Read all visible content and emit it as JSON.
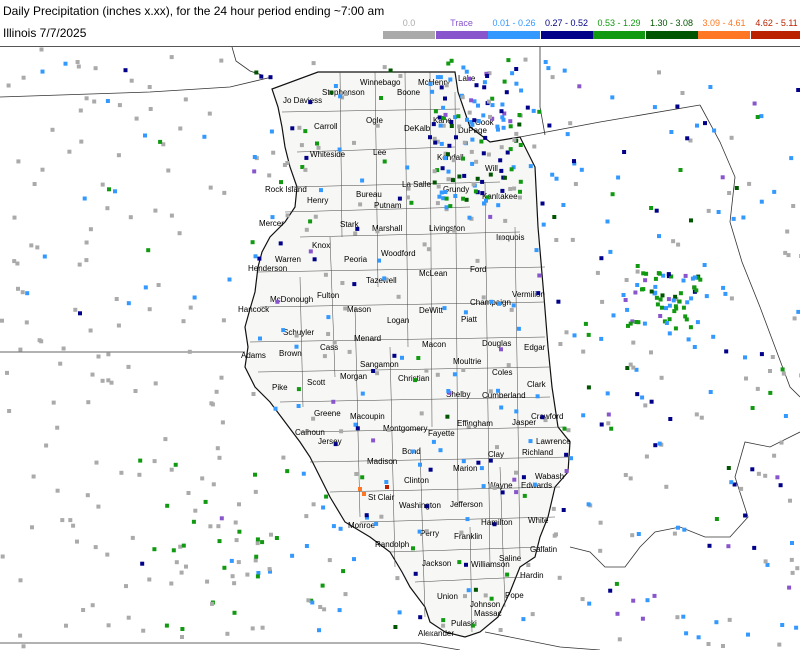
{
  "header": {
    "title": "Daily Precipitation (inches  x.xx),  for the 24 hour period ending ~7:00 am",
    "subtitle": "Illinois 7/7/2025"
  },
  "legend": [
    {
      "label": "0.0",
      "color": "#aaaaaa",
      "text_color": "#aaaaaa"
    },
    {
      "label": "Trace",
      "color": "#8855cc",
      "text_color": "#8855cc"
    },
    {
      "label": "0.01 - 0.26",
      "color": "#3399ff",
      "text_color": "#3399ff"
    },
    {
      "label": "0.27 - 0.52",
      "color": "#000088",
      "text_color": "#000088"
    },
    {
      "label": "0.53 - 1.29",
      "color": "#119911",
      "text_color": "#119911"
    },
    {
      "label": "1.30 - 3.08",
      "color": "#005500",
      "text_color": "#005500"
    },
    {
      "label": "3.09 - 4.61",
      "color": "#ff7722",
      "text_color": "#ff7722"
    },
    {
      "label": "4.62 - 5.11",
      "color": "#bb2200",
      "text_color": "#bb2200"
    }
  ],
  "map": {
    "state_fill": "#f7f7f5",
    "counties": [
      {
        "name": "Jo Daviess"
      },
      {
        "name": "Stephenson"
      },
      {
        "name": "Winnebago"
      },
      {
        "name": "Boone"
      },
      {
        "name": "McHenry"
      },
      {
        "name": "Lake"
      },
      {
        "name": "Carroll"
      },
      {
        "name": "Ogle"
      },
      {
        "name": "DeKalb"
      },
      {
        "name": "Kane"
      },
      {
        "name": "Cook"
      },
      {
        "name": "DuPage"
      },
      {
        "name": "Whiteside"
      },
      {
        "name": "Lee"
      },
      {
        "name": "Kendall"
      },
      {
        "name": "Will"
      },
      {
        "name": "Rock Island"
      },
      {
        "name": "Henry"
      },
      {
        "name": "Bureau"
      },
      {
        "name": "La Salle"
      },
      {
        "name": "Grundy"
      },
      {
        "name": "Kankakee"
      },
      {
        "name": "Putnam"
      },
      {
        "name": "Mercer"
      },
      {
        "name": "Stark"
      },
      {
        "name": "Marshall"
      },
      {
        "name": "Livingston"
      },
      {
        "name": "Iroquois"
      },
      {
        "name": "Knox"
      },
      {
        "name": "Warren"
      },
      {
        "name": "Peoria"
      },
      {
        "name": "Woodford"
      },
      {
        "name": "Henderson"
      },
      {
        "name": "Tazewell"
      },
      {
        "name": "McLean"
      },
      {
        "name": "Ford"
      },
      {
        "name": "Fulton"
      },
      {
        "name": "McDonough"
      },
      {
        "name": "Hancock"
      },
      {
        "name": "Mason"
      },
      {
        "name": "DeWitt"
      },
      {
        "name": "Champaign"
      },
      {
        "name": "Vermilion"
      },
      {
        "name": "Schuyler"
      },
      {
        "name": "Logan"
      },
      {
        "name": "Piatt"
      },
      {
        "name": "Menard"
      },
      {
        "name": "Cass"
      },
      {
        "name": "Adams"
      },
      {
        "name": "Brown"
      },
      {
        "name": "Macon"
      },
      {
        "name": "Douglas"
      },
      {
        "name": "Edgar"
      },
      {
        "name": "Sangamon"
      },
      {
        "name": "Morgan"
      },
      {
        "name": "Moultrie"
      },
      {
        "name": "Scott"
      },
      {
        "name": "Christian"
      },
      {
        "name": "Pike"
      },
      {
        "name": "Coles"
      },
      {
        "name": "Clark"
      },
      {
        "name": "Shelby"
      },
      {
        "name": "Cumberland"
      },
      {
        "name": "Greene"
      },
      {
        "name": "Macoupin"
      },
      {
        "name": "Montgomery"
      },
      {
        "name": "Effingham"
      },
      {
        "name": "Jasper"
      },
      {
        "name": "Crawford"
      },
      {
        "name": "Calhoun"
      },
      {
        "name": "Jersey"
      },
      {
        "name": "Fayette"
      },
      {
        "name": "Lawrence"
      },
      {
        "name": "Bond"
      },
      {
        "name": "Clay"
      },
      {
        "name": "Richland"
      },
      {
        "name": "Madison"
      },
      {
        "name": "Marion"
      },
      {
        "name": "Wabash"
      },
      {
        "name": "Clinton"
      },
      {
        "name": "St Clair"
      },
      {
        "name": "Wayne"
      },
      {
        "name": "Edwards"
      },
      {
        "name": "Washington"
      },
      {
        "name": "Jefferson"
      },
      {
        "name": "Monroe"
      },
      {
        "name": "White"
      },
      {
        "name": "Hamilton"
      },
      {
        "name": "Perry"
      },
      {
        "name": "Randolph"
      },
      {
        "name": "Franklin"
      },
      {
        "name": "Gallatin"
      },
      {
        "name": "Saline"
      },
      {
        "name": "Jackson"
      },
      {
        "name": "Williamson"
      },
      {
        "name": "Hardin"
      },
      {
        "name": "Union"
      },
      {
        "name": "Johnson"
      },
      {
        "name": "Pope"
      },
      {
        "name": "Massac"
      },
      {
        "name": "Pulaski"
      },
      {
        "name": "Alexander"
      }
    ]
  }
}
